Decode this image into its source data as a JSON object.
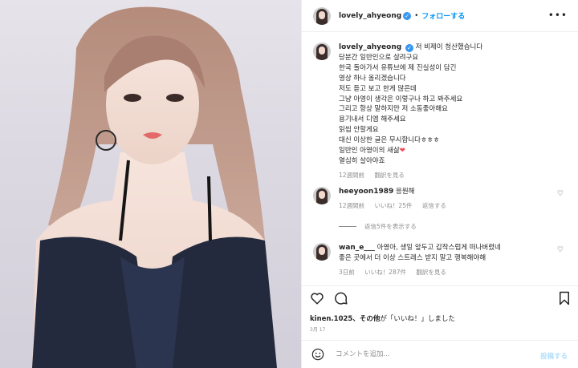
{
  "post": {
    "username": "lovely_ahyeong",
    "dot": "•",
    "follow_label": "フォローする",
    "more_label": "•••"
  },
  "caption": {
    "username": "lovely_ahyeong",
    "lines": [
      "저 비제이 청산했습니다",
      "당분간 일반인으로 살려구요",
      "한국 돌아가서 유튜브에 제 진실성이 담긴",
      "영상 하나 올리겠습니다",
      "저도 듣고 보고 한게 많은데",
      "그냥 아영이 생각은 이렇구나 하고 봐주세요",
      "그리고 항상 말하지만 저 소동좋아해요",
      "용기내서 디엠 해주세요",
      "읽씹 안할게요",
      "대신 이상한 글은 무시합니다ㅎㅎㅎ",
      "일반인 아영이의 새삶",
      "열심히 살아야죠"
    ],
    "time": "12週間前",
    "translate": "翻訳を見る"
  },
  "comments": [
    {
      "username": "heeyoon1989",
      "text": "응원해",
      "time": "12週間前",
      "likes": "いいね！25件",
      "reply": "返信する",
      "view_replies": "返信5件を表示する"
    },
    {
      "username": "wan_e___",
      "text_line1": "아영아, 생일 앞두고 갑작스럽게 떠나버렸네",
      "text_line2": "좋은 곳에서 더 이상 스트레스 받지 말고 행복해야해",
      "time": "3日前",
      "likes": "いいね！287件",
      "translate": "翻訳を見る"
    }
  ],
  "likes": {
    "user": "kinen.1025",
    "rest_bold": "、その他",
    "rest": "が「いいね！」しました",
    "date": "3月 17"
  },
  "add_comment": {
    "placeholder": "コメントを追加...",
    "post_label": "投稿する"
  },
  "colors": {
    "accent": "#0095f6",
    "muted": "#8e8e8e",
    "heart_red": "#ed4956"
  }
}
